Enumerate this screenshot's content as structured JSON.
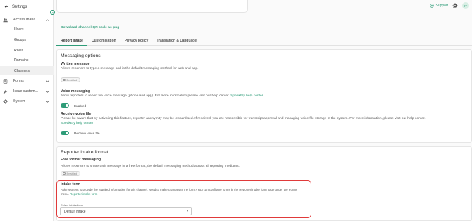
{
  "sidebar": {
    "back_label": "Settings",
    "items": [
      {
        "label": "Access mana..."
      },
      {
        "label": "Forms"
      },
      {
        "label": "Issue custom..."
      },
      {
        "label": "System"
      }
    ],
    "sub_items": [
      "Users",
      "Groups",
      "Roles",
      "Domains",
      "Channels"
    ],
    "active_sub": "Channels"
  },
  "header": {
    "support_label": "Support",
    "avatar_initials": "IT"
  },
  "download_link": "Download channel QR code as png",
  "tabs": [
    "Report intake",
    "Customisation",
    "Privacy policy",
    "Translation & Language"
  ],
  "messaging": {
    "title": "Messaging options",
    "written": {
      "title": "Written message",
      "desc": "Allows reporters to type a message and is the default messaging method for web and app.",
      "status": "Enabled"
    },
    "voice": {
      "title": "Voice messaging",
      "desc": "Allow reporters to report via voice message (phone and app). For more information please visit our help center.",
      "link": "SpeakEly help center",
      "toggle_label": "Enabled"
    },
    "voice_file": {
      "title": "Receive voice file",
      "desc": "Please be aware that by activating this feature, reporter anonymity may be jeopardised. If received, you are responsible for transcript approval and managing voice file storage in the system. For more information, please visit our help center.",
      "link": "SpeakEly help center",
      "toggle_label": "Receive voice file"
    }
  },
  "intake_format": {
    "title": "Reporter intake format",
    "free": {
      "title": "Free format messaging",
      "desc": "Allows reporters to share their message in a free format, the default messaging method across all reporting mediums.",
      "status": "Enabled"
    },
    "intake_form": {
      "title": "Intake form",
      "desc_line1": "Ask reporters to provide the required information for this channel. Need to make changes to the form? You can configure forms in the Reporter intake form page under the Forms",
      "desc_line2_prefix": "menu.",
      "link": "Reporter intake form",
      "select_label": "Select intake form",
      "select_value": "Default intake"
    }
  },
  "colors": {
    "accent": "#2e9c78",
    "highlight": "#e03a3a"
  }
}
